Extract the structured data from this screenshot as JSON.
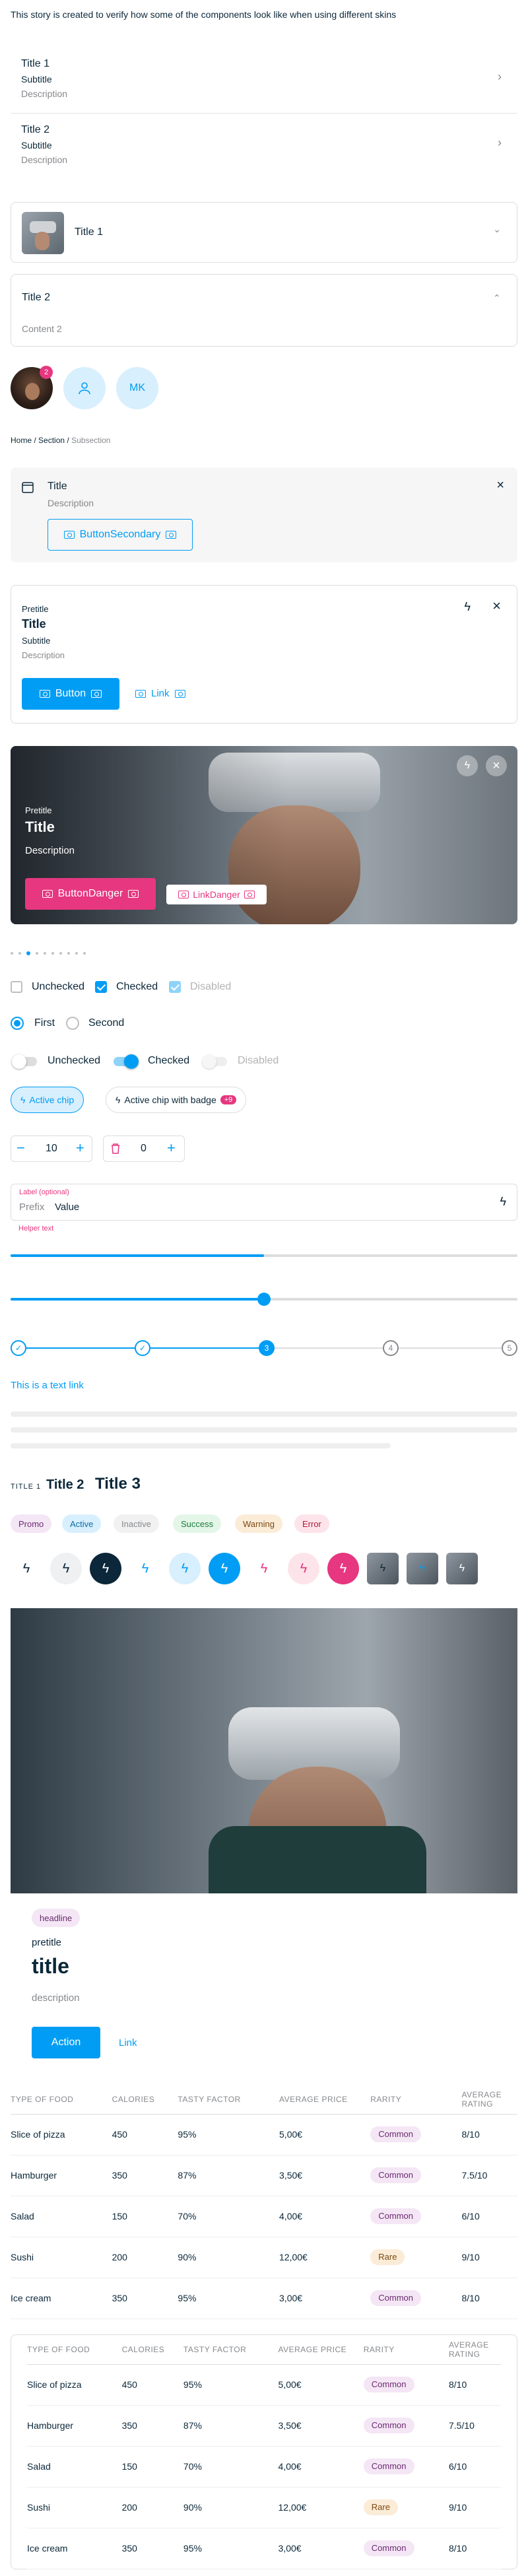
{
  "intro": "This story is created to verify how some of the components look like when using different skins",
  "list_rows": [
    {
      "title": "Title 1",
      "subtitle": "Subtitle",
      "description": "Description"
    },
    {
      "title": "Title 2",
      "subtitle": "Subtitle",
      "description": "Description"
    }
  ],
  "accordion": [
    {
      "title": "Title 1",
      "expanded": false
    },
    {
      "title": "Title 2",
      "content": "Content 2",
      "expanded": true
    }
  ],
  "avatars": {
    "badge_count": "2",
    "initials": "MK"
  },
  "breadcrumb": {
    "items": [
      "Home",
      "Section"
    ],
    "separator": "/",
    "current": "Subsection"
  },
  "callout": {
    "title": "Title",
    "description": "Description",
    "button": "ButtonSecondary"
  },
  "data_card": {
    "pretitle": "Pretitle",
    "title": "Title",
    "subtitle": "Subtitle",
    "description": "Description",
    "button": "Button",
    "link": "Link"
  },
  "media_card": {
    "pretitle": "Pretitle",
    "title": "Title",
    "description": "Description",
    "button": "ButtonDanger",
    "link": "LinkDanger"
  },
  "carousel": {
    "pages": 10,
    "active_index": 2
  },
  "checkboxes": [
    {
      "label": "Unchecked",
      "state": "unchecked"
    },
    {
      "label": "Checked",
      "state": "checked"
    },
    {
      "label": "Disabled",
      "state": "disabled"
    }
  ],
  "radios": [
    {
      "label": "First",
      "selected": true
    },
    {
      "label": "Second",
      "selected": false
    }
  ],
  "switches": [
    {
      "label": "Unchecked",
      "state": "off"
    },
    {
      "label": "Checked",
      "state": "on"
    },
    {
      "label": "Disabled",
      "state": "disabled"
    }
  ],
  "chips": [
    {
      "label": "Active chip",
      "active": true
    },
    {
      "label": "Active chip with badge",
      "active": false,
      "badge": "+9"
    }
  ],
  "steppers": [
    {
      "value": "10"
    },
    {
      "value": "0"
    }
  ],
  "text_field": {
    "label": "Label (optional)",
    "prefix": "Prefix",
    "value": "Value",
    "helper": "Helper text"
  },
  "progress": {
    "value_fraction": 0.5
  },
  "slider": {
    "value_fraction": 0.5
  },
  "steps": {
    "labels": [
      "",
      "",
      "3",
      "4",
      "5"
    ],
    "current": 3
  },
  "text_link": "This is a text link",
  "titles": {
    "t1": "TITLE 1",
    "t2": "Title 2",
    "t3": "Title 3"
  },
  "tags": [
    {
      "label": "Promo",
      "kind": "promo"
    },
    {
      "label": "Active",
      "kind": "active"
    },
    {
      "label": "Inactive",
      "kind": "inactive"
    },
    {
      "label": "Success",
      "kind": "success"
    },
    {
      "label": "Warning",
      "kind": "warning"
    },
    {
      "label": "Error",
      "kind": "error"
    }
  ],
  "hero": {
    "headline": "headline",
    "pretitle": "pretitle",
    "title": "title",
    "description": "description",
    "button": "Action",
    "link": "Link"
  },
  "table": {
    "headers": [
      "TYPE OF FOOD",
      "CALORIES",
      "TASTY FACTOR",
      "AVERAGE PRICE",
      "RARITY",
      "AVERAGE RATING"
    ],
    "rows": [
      [
        "Slice of pizza",
        "450",
        "95%",
        "5,00€",
        "Common",
        "8/10"
      ],
      [
        "Hamburger",
        "350",
        "87%",
        "3,50€",
        "Common",
        "7.5/10"
      ],
      [
        "Salad",
        "150",
        "70%",
        "4,00€",
        "Common",
        "6/10"
      ],
      [
        "Sushi",
        "200",
        "90%",
        "12,00€",
        "Rare",
        "9/10"
      ],
      [
        "Ice cream",
        "350",
        "95%",
        "3,00€",
        "Common",
        "8/10"
      ]
    ]
  },
  "colors": {
    "brand": "#019df4",
    "danger": "#e63780",
    "text": "#0b2739",
    "muted": "#86888c",
    "border": "#dddddd"
  }
}
